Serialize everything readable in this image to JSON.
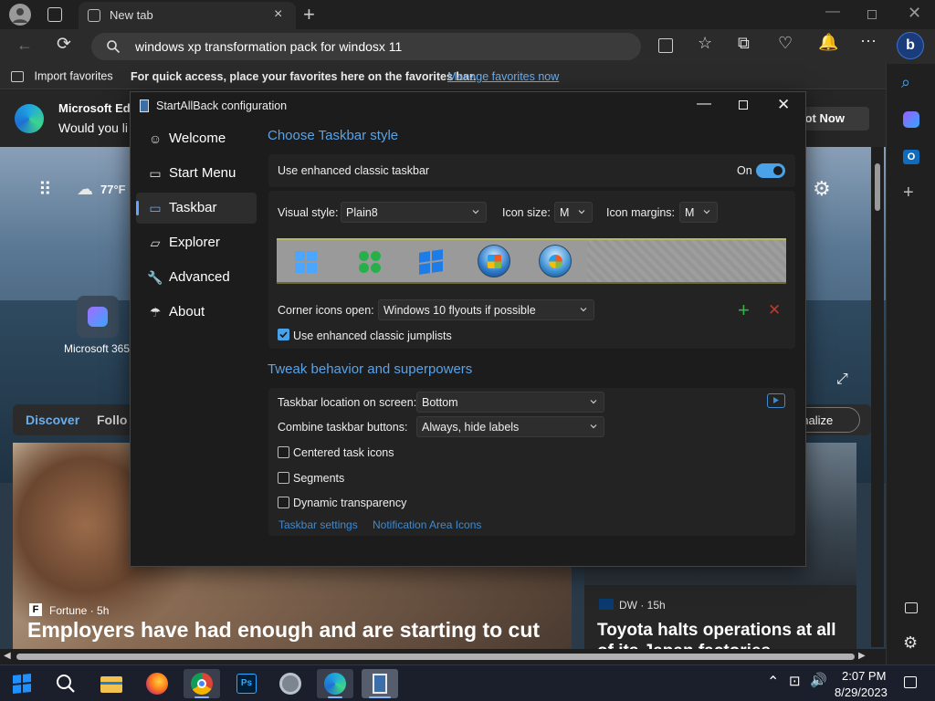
{
  "browser": {
    "tab_title": "New tab",
    "address": "windows xp transformation pack for windosx 11",
    "favbar": {
      "import_label": "Import favorites",
      "hint": "For quick access, place your favorites here on the favorites bar.",
      "manage_link": "Manage favorites now"
    }
  },
  "page": {
    "promo_title": "Microsoft Edg",
    "promo_sub": "Would you li",
    "promo_button": "lot Now",
    "weather": "77°F",
    "app_label": "Microsoft 365",
    "tab_discover": "Discover",
    "tab_following": "Follo",
    "personalize": "onalize",
    "news1_source": "Fortune · 5h",
    "news1_headline": "Employers have had enough and are starting to cut",
    "news2_source": "DW · 15h",
    "news2_headline": "Toyota halts operations at all",
    "news2_headline2": "of its Japan factories"
  },
  "dialog": {
    "title": "StartAllBack configuration",
    "nav": [
      {
        "label": "Welcome"
      },
      {
        "label": "Start Menu"
      },
      {
        "label": "Taskbar"
      },
      {
        "label": "Explorer"
      },
      {
        "label": "Advanced"
      },
      {
        "label": "About"
      }
    ],
    "section1_title": "Choose Taskbar style",
    "enhanced_label": "Use enhanced classic taskbar",
    "toggle_state": "On",
    "visual_style_label": "Visual style:",
    "visual_style_value": "Plain8",
    "icon_size_label": "Icon size:",
    "icon_size_value": "M",
    "icon_margins_label": "Icon margins:",
    "icon_margins_value": "M",
    "corner_label": "Corner icons open:",
    "corner_value": "Windows 10 flyouts if possible",
    "jumplists_label": "Use enhanced classic jumplists",
    "jumplists_checked": true,
    "section2_title": "Tweak behavior and superpowers",
    "location_label": "Taskbar location on screen:",
    "location_value": "Bottom",
    "combine_label": "Combine taskbar buttons:",
    "combine_value": "Always, hide labels",
    "centered_label": "Centered task icons",
    "segments_label": "Segments",
    "dynamic_label": "Dynamic transparency",
    "link_taskbar": "Taskbar settings",
    "link_notification": "Notification Area Icons"
  },
  "taskbar": {
    "time": "2:07 PM",
    "date": "8/29/2023"
  },
  "colors": {
    "accent": "#5aa2e6",
    "toggle_on": "#4aa3e8"
  }
}
